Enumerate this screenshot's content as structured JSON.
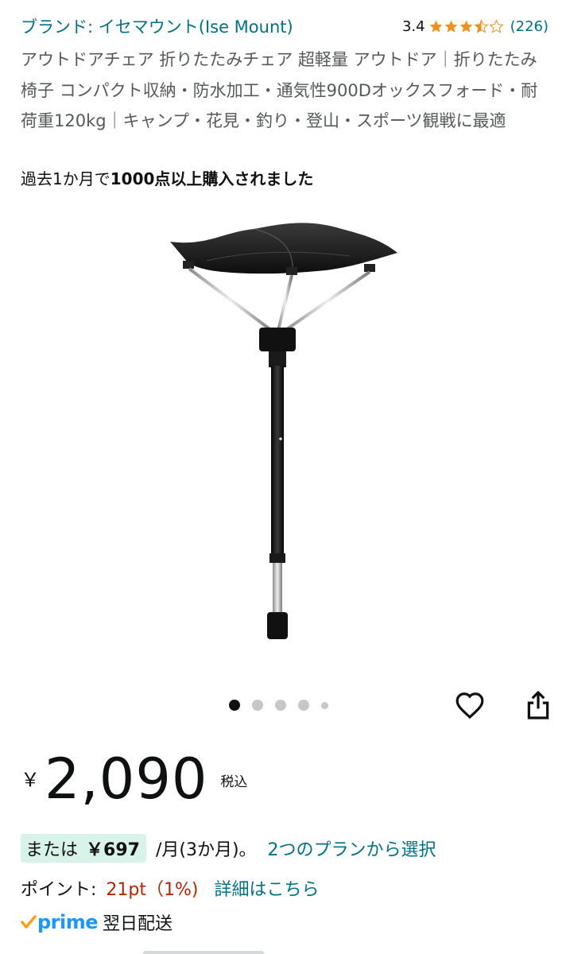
{
  "brand": {
    "label": "ブランド: イセマウント(Ise Mount)"
  },
  "rating": {
    "value": "3.4",
    "stars": 3.5,
    "count": "(226)",
    "star_color": "#f0901e"
  },
  "title": "アウトドアチェア 折りたたみチェア 超軽量 アウトドア｜折りたたみ椅子 コンパクト収納・防水加工・通気性900Dオックスフォード・耐荷重120kg｜キャンプ・花見・釣り・登山・スポーツ観戦に最適",
  "bought": {
    "prefix": "過去1か月で",
    "emphasis": "1000点以上購入されました"
  },
  "image": {
    "subject": "telescopic-tripod-stool",
    "icon": "chair-image"
  },
  "carousel": {
    "count": 5,
    "active_index": 0
  },
  "actions": {
    "favorite_icon": "heart-icon",
    "share_icon": "share-icon"
  },
  "price": {
    "symbol": "￥",
    "amount": "2,090",
    "tax_label": "税込"
  },
  "installment": {
    "prefix": "または",
    "amount": "￥697",
    "period": "/月(3か月)。",
    "plan_link": "2つのプランから選択",
    "badge_color": "#d8f3ea"
  },
  "points": {
    "label": "ポイント:",
    "value": "21pt（1%)",
    "detail_link": "詳細はこちら",
    "value_color": "#b12704"
  },
  "prime": {
    "word": "prime",
    "delivery": "翌日配送",
    "color": "#1a98ff",
    "check_color": "#f79f1b"
  },
  "colors": {
    "link": "#007185",
    "text": "#0f1111",
    "muted": "#565959"
  }
}
